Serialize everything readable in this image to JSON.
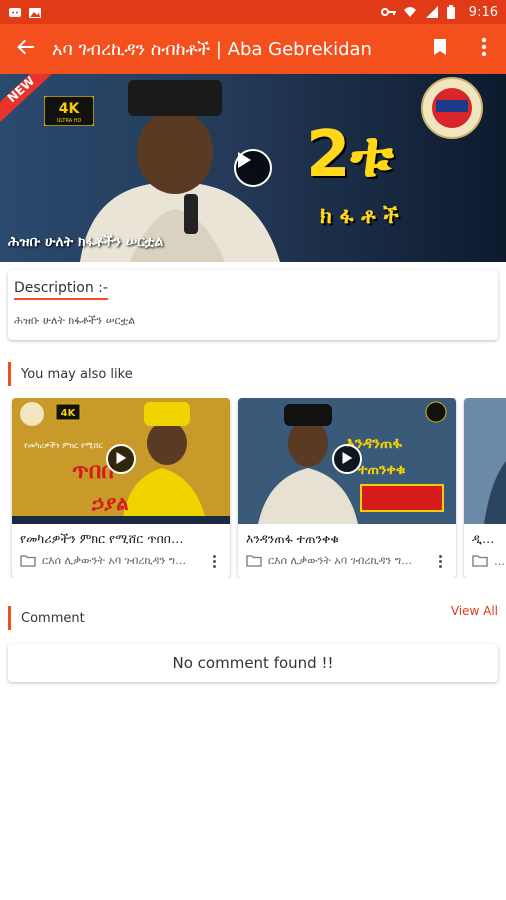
{
  "status_bar": {
    "time": "9:16",
    "bg_color": "#e03a16"
  },
  "app_bar": {
    "title": "አባ ገብረኪዳን ስብከቶች | Aba Gebrekidan",
    "back_icon": "arrow-left-icon",
    "bookmark_icon": "bookmark-icon",
    "more_icon": "more-vert-icon",
    "bg_color": "#f4501e"
  },
  "hero": {
    "caption": "ሕዝቡ ሁለት ክፋቶችን ሠርቷል",
    "badge_new": "NEW",
    "badge_4k": "4K",
    "badge_4k_sub": "ULTRA HD",
    "big_number": "2ቱ",
    "big_subtitle": "ክ ፋ ቶ ች"
  },
  "description": {
    "title": "Description :-",
    "body": "ሕዝቡ ሁለት ክፋቶችን ሠርቷል"
  },
  "recommended": {
    "heading": "You may also like",
    "items": [
      {
        "title": "የመካሪዎችን ምክር የሚሸር ጥበበ…",
        "category": "ርእሰ ሊቃውንት አባ ገብረኪዳን ግ…",
        "thumb_text_1": "ጥበበ",
        "thumb_text_2": "ኃያል"
      },
      {
        "title": "እንዳንጠፋ ተጠንቀቁ",
        "category": "ርእሰ ሊቃውንት አባ ገብረኪዳን ግ…",
        "thumb_text_1": "እንዳንጠፋ",
        "thumb_text_2": "ተጠንቀቁ"
      },
      {
        "title": "ዲ…",
        "category": "…",
        "thumb_text_1": "",
        "thumb_text_2": ""
      }
    ]
  },
  "comments": {
    "heading": "Comment",
    "view_all": "View All",
    "empty_text": "No comment found !!"
  }
}
